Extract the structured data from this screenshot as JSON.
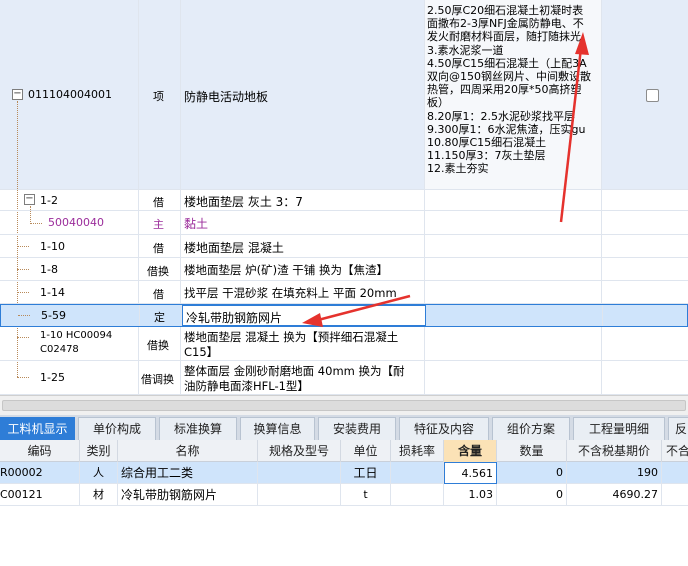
{
  "top_rows": [
    {
      "code": "011104004001",
      "type": "项",
      "name": "防静电活动地板",
      "desc_lines": [
        "2.50厚C20细石混凝土初凝时表",
        "面撒布2-3厚NFJ金属防静电、不",
        "发火耐磨材料面层，随打随抹光",
        "3.素水泥浆一道",
        "4.50厚C15细石混凝土（上配3A",
        "双向@150钢丝网片、中间敷设散",
        "热管，四周采用20厚*50高挤塑",
        "板）",
        "8.20厚1：2.5水泥砂浆找平层",
        "9.300厚1：6水泥焦渣，压实gu",
        "10.80厚C15细石混凝土",
        "11.150厚3：7灰土垫层",
        "12.素土夯实"
      ]
    },
    {
      "code": "1-2",
      "type": "借",
      "name": "楼地面垫层 灰土 3：7"
    },
    {
      "code": "50040040",
      "type": "主",
      "name": "黏土"
    },
    {
      "code": "1-10",
      "type": "借",
      "name": "楼地面垫层 混凝土"
    },
    {
      "code": "1-8",
      "type": "借换",
      "name": "楼地面垫层 炉(矿)渣 干铺    换为【焦渣】"
    },
    {
      "code": "1-14",
      "type": "借",
      "name": "找平层 干混砂浆 在填充料上 平面 20mm"
    },
    {
      "code": "5-59",
      "type": "定",
      "name": "冷轧带肋钢筋网片"
    },
    {
      "code": "1-10 HC00094",
      "code2": "C02478",
      "type": "借换",
      "name": "楼地面垫层 混凝土   换为【预拌细石混凝土",
      "name2": "C15】"
    },
    {
      "code": "1-25",
      "type": "借调换",
      "name": "整体面层 金刚砂耐磨地面 40mm   换为【耐",
      "name2": "油防静电面漆HFL-1型】"
    }
  ],
  "tabs": [
    "工料机显示",
    "单价构成",
    "标准换算",
    "换算信息",
    "安装费用",
    "特征及内容",
    "组价方案",
    "工程量明细",
    "反"
  ],
  "grid_headers": [
    "编码",
    "类别",
    "名称",
    "规格及型号",
    "单位",
    "损耗率",
    "含量",
    "数量",
    "不含税基期价",
    "不合"
  ],
  "grid_rows": [
    {
      "code": "R00002",
      "cat": "人",
      "name": "综合用工二类",
      "spec": "",
      "unit": "工日",
      "loss": "",
      "content": "4.561",
      "qty": "0",
      "price": "190"
    },
    {
      "code": "C00121",
      "cat": "材",
      "name": "冷轧带肋钢筋网片",
      "spec": "",
      "unit": "t",
      "loss": "",
      "content": "1.03",
      "qty": "0",
      "price": "4690.27"
    }
  ],
  "colors": {
    "accent": "#2e7dd7",
    "selected_row": "#cfe4fb",
    "purple_text": "#9b2d9b",
    "annotation_arrow": "#e5322d"
  }
}
